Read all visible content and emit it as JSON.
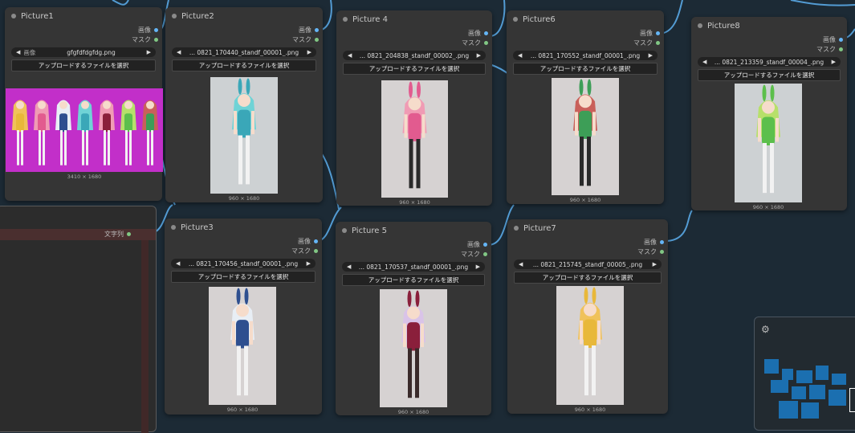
{
  "ports": {
    "image_label": "画像",
    "mask_label": "マスク"
  },
  "selector_prefix": "画像",
  "upload_label": "アップロードするファイルを選択",
  "side_output_label": "文字列",
  "nodes": [
    {
      "title": "Picture1",
      "filename": "gfgfdfdgfdg.png",
      "dims": "3410 × 1680",
      "has_prefix": true
    },
    {
      "title": "Picture2",
      "filename": "... 0821_170440_standf_00001_.png",
      "dims": "960 × 1680"
    },
    {
      "title": "Picture 4",
      "filename": "... 0821_204838_standf_00002_.png",
      "dims": "960 × 1680"
    },
    {
      "title": "Picture6",
      "filename": "... 0821_170552_standf_00001_.png",
      "dims": "960 × 1680"
    },
    {
      "title": "Picture8",
      "filename": "... 0821_213359_standf_00004_.png",
      "dims": "960 × 1680"
    },
    {
      "title": "Picture3",
      "filename": "... 0821_170456_standf_00001_.png",
      "dims": "960 × 1680"
    },
    {
      "title": "Picture 5",
      "filename": "... 0821_170537_standf_00001_.png",
      "dims": "960 × 1680"
    },
    {
      "title": "Picture7",
      "filename": "... 0821_215745_standf_00005_.png",
      "dims": "960 × 1680"
    }
  ],
  "colors": {
    "canvas": "#1c2a35",
    "node": "#353535",
    "wire": "#5aa9e6",
    "image_port": "#64b5f6",
    "mask_port": "#81c784"
  },
  "icons": {
    "mini_panel": "sliders-icon",
    "nav_left": "chevron-left-icon",
    "nav_right": "chevron-right-icon"
  }
}
